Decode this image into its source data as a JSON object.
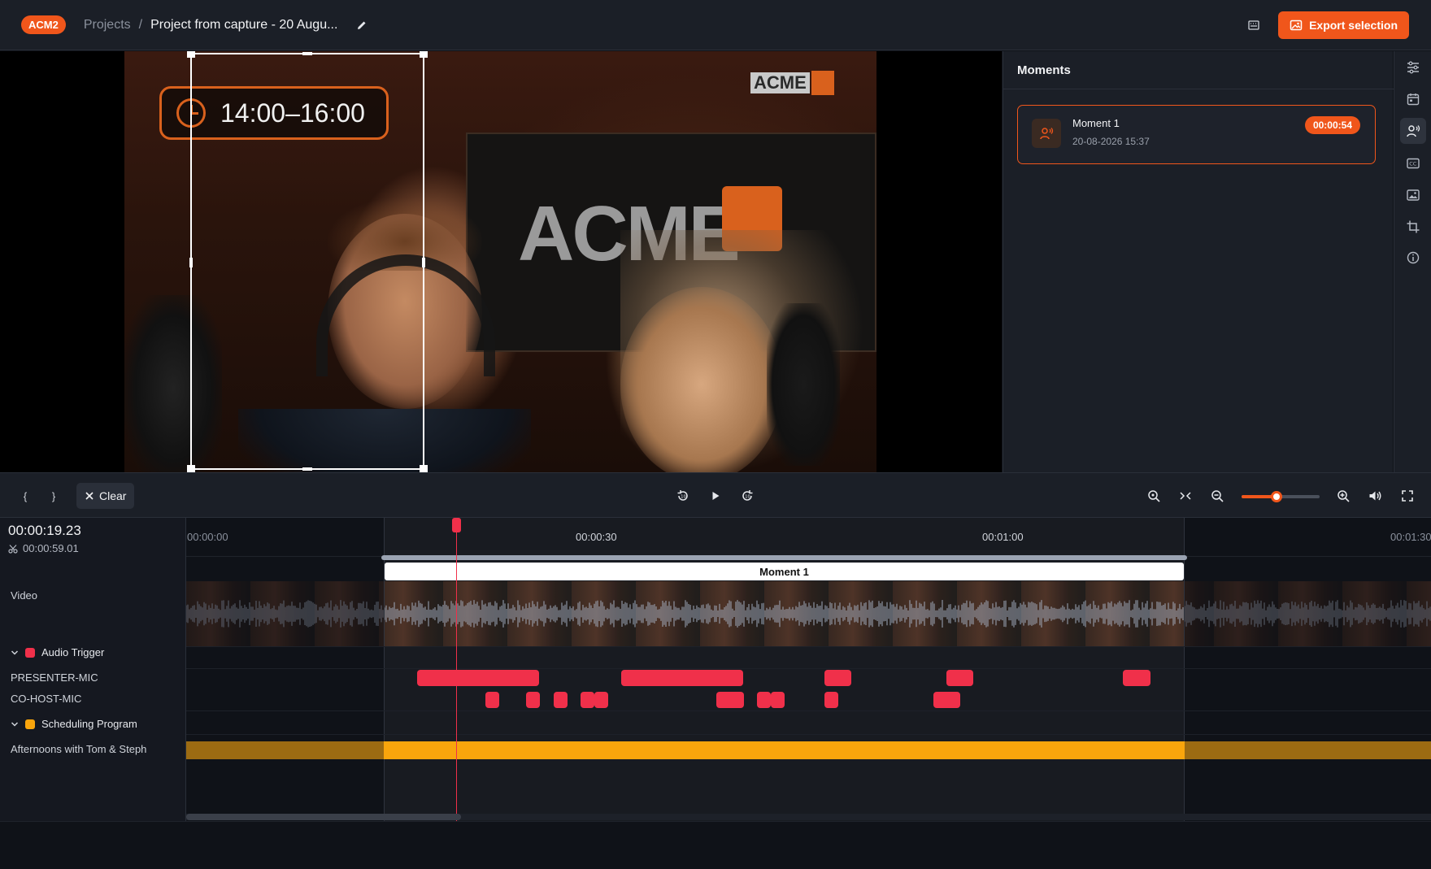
{
  "header": {
    "badge": "ACM2",
    "breadcrumb_projects": "Projects",
    "breadcrumb_sep": "/",
    "project_title": "Project from capture - 20 Augu...",
    "export_label": "Export selection"
  },
  "video": {
    "overlay_time": "14:00–16:00",
    "logo_text": "ACME"
  },
  "moments_panel": {
    "title": "Moments",
    "items": [
      {
        "name": "Moment 1",
        "date": "20-08-2026 15:37",
        "duration": "00:00:54"
      }
    ]
  },
  "rail_icons": [
    "sliders-icon",
    "calendar-icon",
    "person-voice-icon",
    "captions-icon",
    "image-icon",
    "crop-icon",
    "info-icon"
  ],
  "controls": {
    "mark_in": "{",
    "mark_out": "}",
    "clear_label": "Clear",
    "zoom_level": 0.45
  },
  "timeline": {
    "current_time": "00:00:19.23",
    "selection_duration": "00:00:59.01",
    "ticks": [
      "00:00:00",
      "00:00:30",
      "00:01:00",
      "00:01:30"
    ],
    "moment_label": "Moment 1",
    "tracks": {
      "video": "Video",
      "audio_group": "Audio Trigger",
      "audio_tracks": [
        "PRESENTER-MIC",
        "CO-HOST-MIC"
      ],
      "schedule_group": "Scheduling Program",
      "schedule_tracks": [
        "Afternoons with Tom & Steph"
      ]
    },
    "colors": {
      "audio_trigger": "#f0304a",
      "schedule": "#f9a50c",
      "accent": "#f0561b"
    }
  }
}
